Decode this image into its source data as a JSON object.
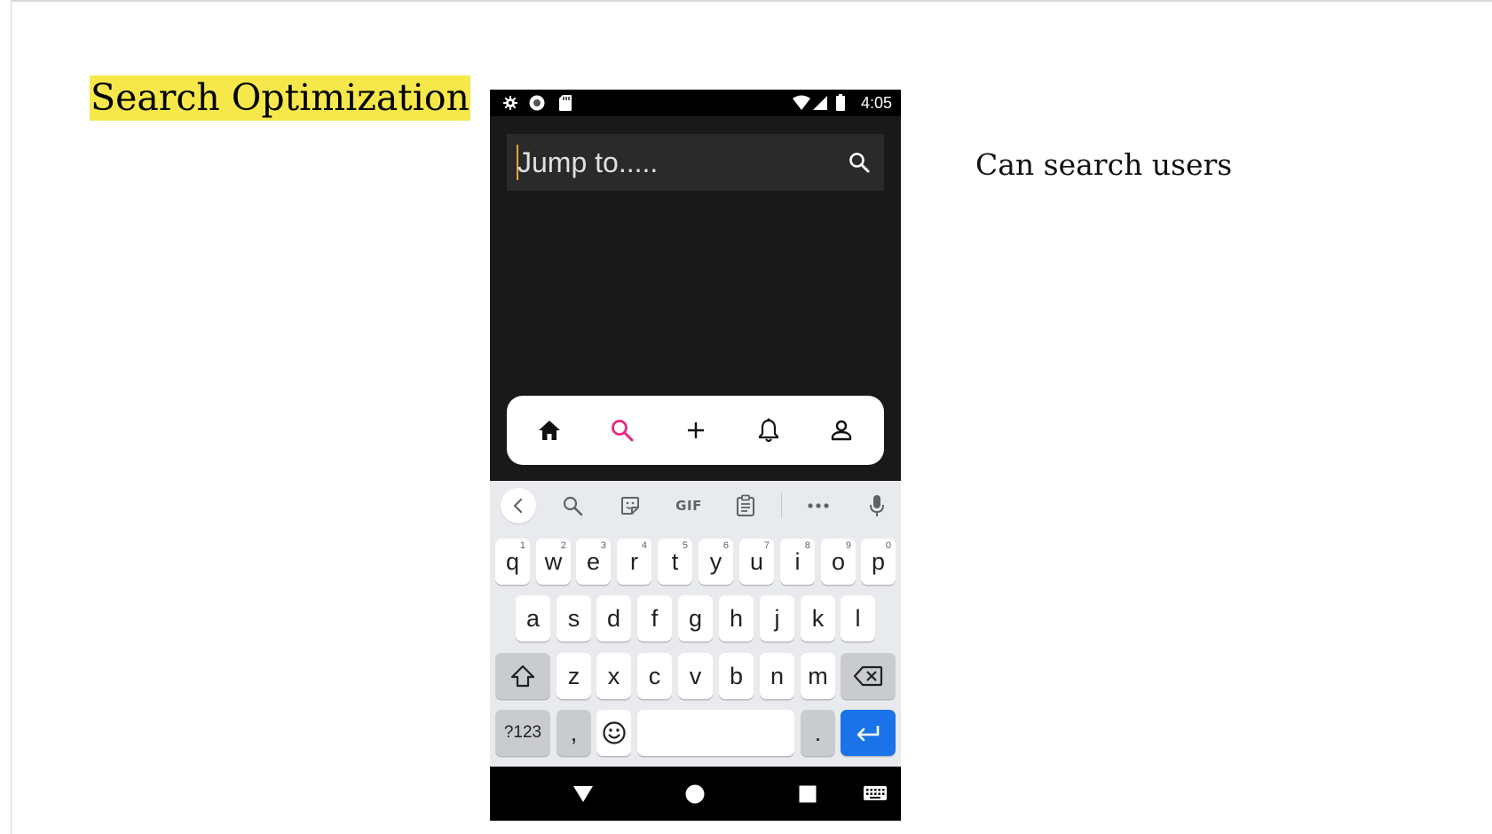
{
  "slide": {
    "title": "Search Optimization",
    "note": "Can search users",
    "title_highlight_color": "#f6e84a"
  },
  "phone": {
    "status_bar": {
      "time": "4:05",
      "left_icons": [
        "settings-icon",
        "record-icon",
        "sd-card-icon"
      ],
      "right_icons": [
        "wifi-icon",
        "signal-icon",
        "battery-icon"
      ]
    },
    "search": {
      "value": "Jump to.....",
      "icon": "search-icon"
    },
    "bottom_nav": {
      "items": [
        {
          "name": "home",
          "icon": "home-icon",
          "active": false
        },
        {
          "name": "search",
          "icon": "search-icon",
          "active": true
        },
        {
          "name": "create",
          "icon": "plus-icon",
          "active": false
        },
        {
          "name": "notifications",
          "icon": "bell-icon",
          "active": false
        },
        {
          "name": "profile",
          "icon": "person-icon",
          "active": false
        }
      ],
      "active_color": "#e8267f"
    },
    "keyboard": {
      "toolbar": {
        "gif_label": "GIF",
        "items": [
          "back-icon",
          "search-icon",
          "sticker-icon",
          "gif-icon",
          "clipboard-icon",
          "more-icon",
          "mic-icon"
        ]
      },
      "rows": {
        "row1": [
          {
            "key": "q",
            "hint": "1"
          },
          {
            "key": "w",
            "hint": "2"
          },
          {
            "key": "e",
            "hint": "3"
          },
          {
            "key": "r",
            "hint": "4"
          },
          {
            "key": "t",
            "hint": "5"
          },
          {
            "key": "y",
            "hint": "6"
          },
          {
            "key": "u",
            "hint": "7"
          },
          {
            "key": "i",
            "hint": "8"
          },
          {
            "key": "o",
            "hint": "9"
          },
          {
            "key": "p",
            "hint": "0"
          }
        ],
        "row2": [
          "a",
          "s",
          "d",
          "f",
          "g",
          "h",
          "j",
          "k",
          "l"
        ],
        "row3": [
          "z",
          "x",
          "c",
          "v",
          "b",
          "n",
          "m"
        ],
        "row4": {
          "symbols": "?123",
          "comma": ",",
          "period": "."
        }
      },
      "enter_color": "#1a73e8"
    },
    "system_nav": [
      "back-triangle-icon",
      "home-circle-icon",
      "recents-square-icon",
      "keyboard-icon"
    ]
  }
}
